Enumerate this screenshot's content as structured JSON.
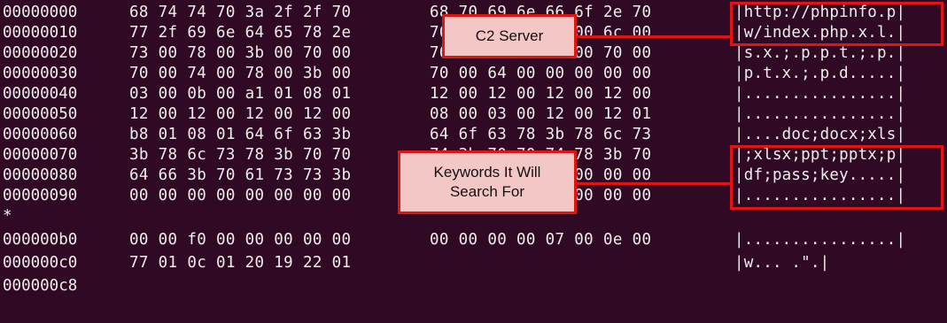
{
  "rows": [
    {
      "offset": "00000000",
      "hex1": "68 74 74 70 3a 2f 2f 70",
      "hex2": "68 70 69 6e 66 6f 2e 70",
      "ascii": "|http://phpinfo.p|"
    },
    {
      "offset": "00000010",
      "hex1": "77 2f 69 6e 64 65 78 2e",
      "hex2": "70 68 70 00 78 00 6c 00",
      "ascii": "|w/index.php.x.l.|"
    },
    {
      "offset": "00000020",
      "hex1": "73 00 78 00 3b 00 70 00",
      "hex2": "70 00 74 00 3b 00 70 00",
      "ascii": "|s.x.;.p.p.t.;.p.|"
    },
    {
      "offset": "00000030",
      "hex1": "70 00 74 00 78 00 3b 00",
      "hex2": "70 00 64 00 00 00 00 00",
      "ascii": "|p.t.x.;.p.d.....|"
    },
    {
      "offset": "00000040",
      "hex1": "03 00 0b 00 a1 01 08 01",
      "hex2": "12 00 12 00 12 00 12 00",
      "ascii": "|................|"
    },
    {
      "offset": "00000050",
      "hex1": "12 00 12 00 12 00 12 00",
      "hex2": "08 00 03 00 12 00 12 01",
      "ascii": "|................|"
    },
    {
      "offset": "00000060",
      "hex1": "b8 01 08 01 64 6f 63 3b",
      "hex2": "64 6f 63 78 3b 78 6c 73",
      "ascii": "|....doc;docx;xls|"
    },
    {
      "offset": "00000070",
      "hex1": "3b 78 6c 73 78 3b 70 70",
      "hex2": "74 3b 70 70 74 78 3b 70",
      "ascii": "|;xlsx;ppt;pptx;p|"
    },
    {
      "offset": "00000080",
      "hex1": "64 66 3b 70 61 73 73 3b",
      "hex2": "6b 65 79 00 00 00 00 00",
      "ascii": "|df;pass;key.....|"
    },
    {
      "offset": "00000090",
      "hex1": "00 00 00 00 00 00 00 00",
      "hex2": "00 00 00 00 00 00 00 00",
      "ascii": "|................|"
    }
  ],
  "repeat_marker": "*",
  "rows_after": [
    {
      "offset": "000000b0",
      "hex1": "00 00 f0 00 00 00 00 00",
      "hex2": "00 00 00 00 07 00 0e 00",
      "ascii": "|................|"
    },
    {
      "offset": "000000c0",
      "hex1": "77 01 0c 01 20 19 22 01",
      "hex2": "",
      "ascii": "|w... .\".|"
    },
    {
      "offset": "000000c8",
      "hex1": "",
      "hex2": "",
      "ascii": ""
    }
  ],
  "callouts": {
    "c2_label": "C2 Server",
    "keywords_line1": "Keywords It Will",
    "keywords_line2": "Search For"
  },
  "colors": {
    "terminal_bg": "#300a24",
    "text": "#eeeeec",
    "highlight": "#e01414",
    "callout_fill": "#f4c7c7"
  }
}
